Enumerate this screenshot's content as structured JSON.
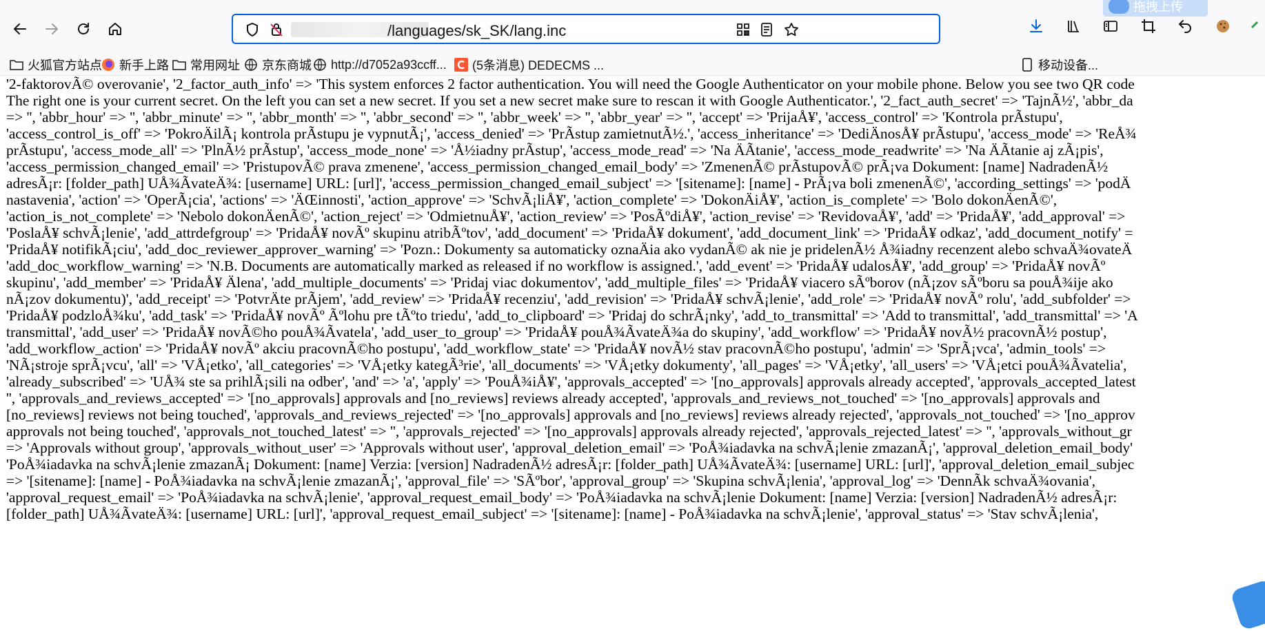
{
  "browser": {
    "url": "/languages/sk_SK/lang.inc",
    "upload_badge": "拖拽上传",
    "bookmarks": [
      {
        "label": "火狐官方站点"
      },
      {
        "label": "新手上路"
      },
      {
        "label": "常用网址"
      },
      {
        "label": "京东商城"
      },
      {
        "label": "http://d7052a93ccff..."
      },
      {
        "label": "(5条消息) DEDECMS ..."
      },
      {
        "label": "移动设备..."
      }
    ]
  },
  "content": {
    "lines": [
      "'2-faktorovÃ© overovanie', '2_factor_auth_info' => 'This system enforces 2 factor authentication. You will need the Google Authenticator on your mobile phone. Below you see two QR code",
      "The right one is your current secret. On the left you can set a new secret. If you set a new secret make sure to rescan it with Google Authenticator.', '2_fact_auth_secret' => 'TajnÃ½', 'abbr_da",
      "=> '', 'abbr_hour' => '', 'abbr_minute' => '', 'abbr_month' => '', 'abbr_second' => '', 'abbr_week' => '', 'abbr_year' => '', 'accept' => 'PrijaÅ¥', 'access_control' => 'Kontrola prÃstupu',",
      "'access_control_is_off' => 'PokroÄilÃ¡ kontrola prÃstupu je vypnutÃ¡', 'access_denied' => 'PrÃstup zamietnutÃ½.', 'access_inheritance' => 'DediÄnosÅ¥ prÃstupu', 'access_mode' => 'ReÅ¾",
      "prÃstupu', 'access_mode_all' => 'PlnÃ½ prÃstup', 'access_mode_none' => 'Å½iadny prÃstup', 'access_mode_read' => 'Na ÄÃtanie', 'access_mode_readwrite' => 'Na ÄÃtanie aj zÃ¡pis',",
      "'access_permission_changed_email' => 'PristupovÃ© prava zmenene', 'access_permission_changed_email_body' => 'ZmenenÃ© prÃstupovÃ© prÃ¡va Dokument: [name] NadradenÃ½",
      "adresÃ¡r: [folder_path] UÅ¾ÃvateÄ¾: [username] URL: [url]', 'access_permission_changed_email_subject' => '[sitename]: [name] - PrÃ¡va boli zmenenÃ©', 'according_settings' => 'podÄ",
      "nastavenia', 'action' => 'OperÃ¡cia', 'actions' => 'ÄŒinnosti', 'action_approve' => 'SchvÃ¡liÅ¥', 'action_complete' => 'DokonÄiÅ¥', 'action_is_complete' => 'Bolo dokonÄenÃ©',",
      "'action_is_not_complete' => 'Nebolo dokonÄenÃ©', 'action_reject' => 'OdmietnuÅ¥', 'action_review' => 'PosÃºdiÅ¥', 'action_revise' => 'RevidovaÅ¥', 'add' => 'PridaÅ¥', 'add_approval' =>",
      "'PoslaÅ¥ schvÃ¡lenie', 'add_attrdefgroup' => 'PridaÅ¥ novÃº skupinu atribÃºtov', 'add_document' => 'PridaÅ¥ dokument', 'add_document_link' => 'PridaÅ¥ odkaz', 'add_document_notify' =",
      "'PridaÅ¥ notifikÃ¡ciu', 'add_doc_reviewer_approver_warning' => 'Pozn.: Dokumenty sa automaticky oznaÄia ako vydanÃ© ak nie je pridelenÃ½ Å¾iadny recenzent alebo schvaÄ¾ovateÄ",
      "'add_doc_workflow_warning' => 'N.B. Documents are automatically marked as released if no workflow is assigned.', 'add_event' => 'PridaÅ¥ udalosÅ¥', 'add_group' => 'PridaÅ¥ novÃº",
      "skupinu', 'add_member' => 'PridaÅ¥ Älena', 'add_multiple_documents' => 'Pridaj viac dokumentov', 'add_multiple_files' => 'PridaÅ¥ viacero sÃºborov (nÃ¡zov sÃºboru sa pouÅ¾ije ako",
      "nÃ¡zov dokumentu)', 'add_receipt' => 'PotvrÄte prÃjem', 'add_review' => 'PridaÅ¥ recenziu', 'add_revision' => 'PridaÅ¥ schvÃ¡lenie', 'add_role' => 'PridaÅ¥ novÃº rolu', 'add_subfolder' =>",
      "'PridaÅ¥ podzloÅ¾ku', 'add_task' => 'PridaÅ¥ novÃº Ãºlohu pre tÃºto triedu', 'add_to_clipboard' => 'Pridaj do schrÃ¡nky', 'add_to_transmittal' => 'Add to transmittal', 'add_transmittal' => 'A",
      "transmittal', 'add_user' => 'PridaÅ¥ novÃ©ho pouÅ¾Ãvatela', 'add_user_to_group' => 'PridaÅ¥ pouÅ¾ÃvateÄ¾a do skupiny', 'add_workflow' => 'PridaÅ¥ novÃ½ pracovnÃ½ postup',",
      "'add_workflow_action' => 'PridaÅ¥ novÃº akciu pracovnÃ©ho postupu', 'add_workflow_state' => 'PridaÅ¥ novÃ½ stav pracovnÃ©ho postupu', 'admin' => 'SprÃ¡vca', 'admin_tools' =>",
      "'NÃ¡stroje sprÃ¡vcu', 'all' => 'VÅ¡etko', 'all_categories' => 'VÅ¡etky kategÃ³rie', 'all_documents' => 'VÅ¡etky dokumenty', 'all_pages' => 'VÅ¡etky', 'all_users' => 'VÅ¡etci pouÅ¾Ãvatelia',",
      "'already_subscribed' => 'UÅ¾ ste sa prihlÃ¡sili na odber', 'and' => 'a', 'apply' => 'PouÅ¾iÅ¥', 'approvals_accepted' => '[no_approvals] approvals already accepted', 'approvals_accepted_latest",
      "'', 'approvals_and_reviews_accepted' => '[no_approvals] approvals and [no_reviews] reviews already accepted', 'approvals_and_reviews_not_touched' => '[no_approvals] approvals and",
      "[no_reviews] reviews not being touched', 'approvals_and_reviews_rejected' => '[no_approvals] approvals and [no_reviews] reviews already rejected', 'approvals_not_touched' => '[no_approv",
      "approvals not being touched', 'approvals_not_touched_latest' => '', 'approvals_rejected' => '[no_approvals] approvals already rejected', 'approvals_rejected_latest' => '', 'approvals_without_gr",
      "=> 'Approvals without group', 'approvals_without_user' => 'Approvals without user', 'approval_deletion_email' => 'PoÅ¾iadavka na schvÃ¡lenie zmazanÃ¡', 'approval_deletion_email_body'",
      "'PoÅ¾iadavka na schvÃ¡lenie zmazanÃ¡ Dokument: [name] Verzia: [version] NadradenÃ½ adresÃ¡r: [folder_path] UÅ¾ÃvateÄ¾: [username] URL: [url]', 'approval_deletion_email_subjec",
      "=> '[sitename]: [name] - PoÅ¾iadavka na schvÃ¡lenie zmazanÃ¡', 'approval_file' => 'SÃºbor', 'approval_group' => 'Skupina schvÃ¡lenia', 'approval_log' => 'DennÃk schvaÄ¾ovania',",
      "'approval_request_email' => 'PoÅ¾iadavka na schvÃ¡lenie', 'approval_request_email_body' => 'PoÅ¾iadavka na schvÃ¡lenie Dokument: [name] Verzia: [version] NadradenÃ½ adresÃ¡r:",
      "[folder_path] UÅ¾ÃvateÄ¾: [username] URL: [url]', 'approval_request_email_subject' => '[sitename]: [name] - PoÅ¾iadavka na schvÃ¡lenie', 'approval_status' => 'Stav schvÃ¡lenia',"
    ]
  }
}
